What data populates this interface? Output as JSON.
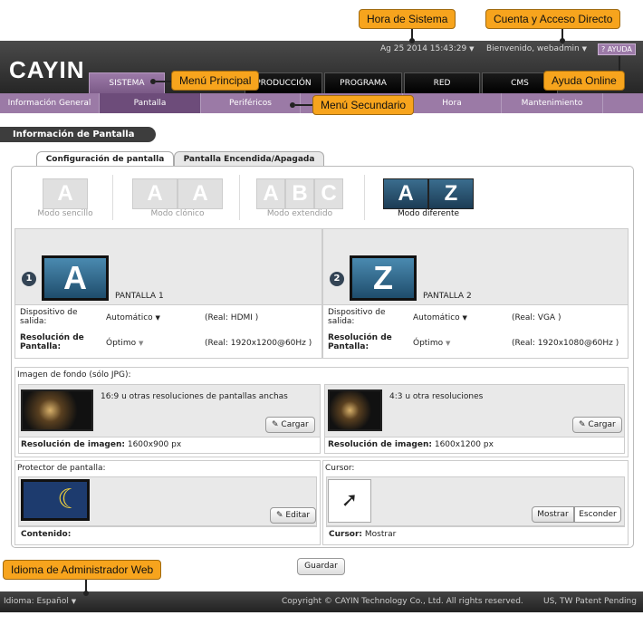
{
  "callouts": {
    "system_time": "Hora de Sistema",
    "account": "Cuenta y Acceso Directo",
    "main_menu": "Menú Principal",
    "online_help": "Ayuda Online",
    "sub_menu": "Menú Secundario",
    "language": "Idioma de Administrador Web"
  },
  "header": {
    "logo": "CAYIN",
    "datetime": "Ag 25 2014 15:43:29",
    "welcome": "Bienvenido, webadmin",
    "help": "AYUDA"
  },
  "main_nav": [
    "SISTEMA",
    "PRODUCCIÓN",
    "PROGRAMA",
    "RED",
    "CMS"
  ],
  "sub_nav": [
    "Información General",
    "Pantalla",
    "Periféricos",
    "Red",
    "Hora",
    "Mantenimiento"
  ],
  "page_title": "Información de Pantalla",
  "tabs": [
    "Configuración de pantalla",
    "Pantalla Encendida/Apagada"
  ],
  "modes": [
    {
      "label": "Modo sencillo",
      "screens": [
        "A"
      ]
    },
    {
      "label": "Modo clónico",
      "screens": [
        "A",
        "A"
      ]
    },
    {
      "label": "Modo extendido",
      "screens": [
        "A",
        "B",
        "C"
      ]
    },
    {
      "label": "Modo diferente",
      "screens": [
        "A",
        "Z"
      ]
    }
  ],
  "displays": [
    {
      "num": "1",
      "letter": "A",
      "name": "PANTALLA 1",
      "device_label": "Dispositivo de salida:",
      "device_value": "Automático",
      "device_real": "(Real: HDMI )",
      "res_label": "Resolución de Pantalla:",
      "res_value": "Óptimo",
      "res_real": "(Real: 1920x1200@60Hz )"
    },
    {
      "num": "2",
      "letter": "Z",
      "name": "PANTALLA 2",
      "device_label": "Dispositivo de salida:",
      "device_value": "Automático",
      "device_real": "(Real: VGA )",
      "res_label": "Resolución de Pantalla:",
      "res_value": "Óptimo",
      "res_real": "(Real: 1920x1080@60Hz )"
    }
  ],
  "background": {
    "title": "Imagen de fondo (sólo JPG):",
    "items": [
      {
        "desc": "16:9 u otras resoluciones de pantallas anchas",
        "button": "Cargar",
        "res_label": "Resolución de imagen:",
        "res_value": "1600x900 px"
      },
      {
        "desc": "4:3 u otra resoluciones",
        "button": "Cargar",
        "res_label": "Resolución de imagen:",
        "res_value": "1600x1200 px"
      }
    ]
  },
  "screensaver": {
    "title": "Protector de pantalla:",
    "button": "Editar",
    "content_label": "Contenido:"
  },
  "cursor": {
    "title": "Cursor:",
    "show": "Mostrar",
    "hide": "Esconder",
    "status_label": "Cursor:",
    "status_value": "Mostrar"
  },
  "save_button": "Guardar",
  "footer": {
    "language": "Idioma: Español",
    "copyright": "Copyright © CAYIN Technology Co., Ltd. All rights reserved.",
    "patent": "US, TW Patent Pending"
  }
}
